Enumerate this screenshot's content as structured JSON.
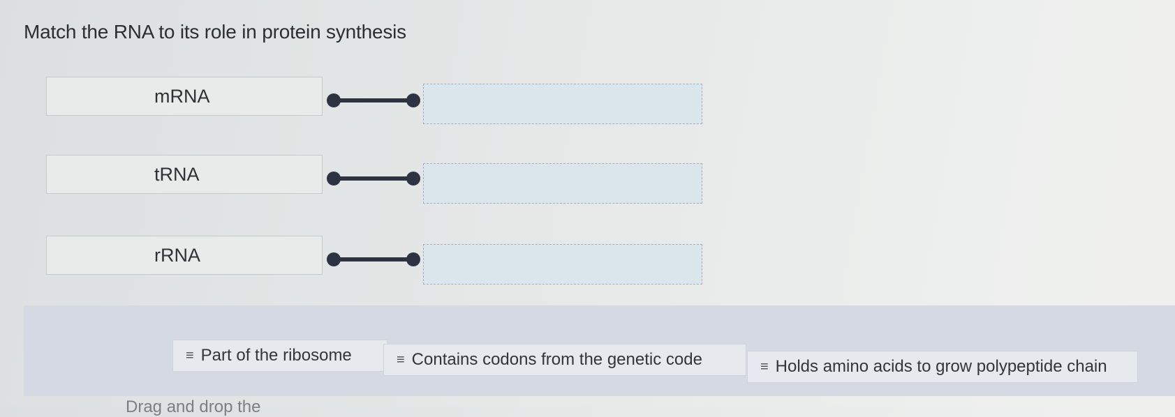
{
  "question": {
    "title": "Match the RNA to its role in protein synthesis"
  },
  "terms": [
    {
      "label": "mRNA"
    },
    {
      "label": "tRNA"
    },
    {
      "label": "rRNA"
    }
  ],
  "answers": [
    {
      "handle_icon": "drag-handle-icon",
      "label": "Part of the ribosome"
    },
    {
      "handle_icon": "drag-handle-icon",
      "label": "Contains codons from the genetic code"
    },
    {
      "handle_icon": "drag-handle-icon",
      "label": "Holds amino acids to grow polypeptide chain"
    }
  ],
  "drop_zones": [
    {
      "value": ""
    },
    {
      "value": ""
    },
    {
      "value": ""
    }
  ],
  "instructions": "Drag and drop the"
}
